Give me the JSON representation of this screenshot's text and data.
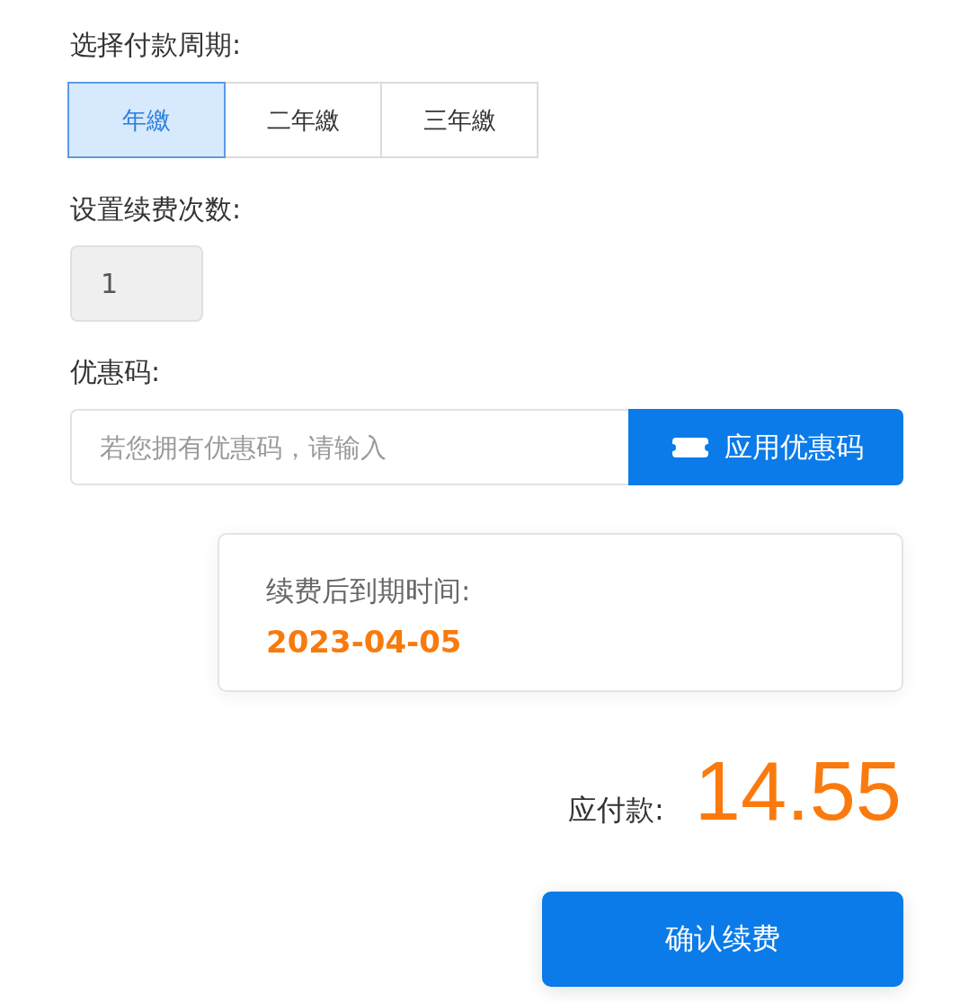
{
  "payment_period": {
    "label": "选择付款周期:",
    "options": [
      {
        "label": "年繳",
        "selected": true
      },
      {
        "label": "二年繳",
        "selected": false
      },
      {
        "label": "三年繳",
        "selected": false
      }
    ]
  },
  "renewal_count": {
    "label": "设置续费次数:",
    "value": "1",
    "disabled": true
  },
  "coupon": {
    "label": "优惠码:",
    "placeholder": "若您拥有优惠码，请输入",
    "button": "应用优惠码"
  },
  "expiry_card": {
    "label": "续费后到期时间:",
    "date": "2023-04-05"
  },
  "total": {
    "label": "应付款:",
    "amount": "14.55"
  },
  "confirm_button": "确认续费"
}
